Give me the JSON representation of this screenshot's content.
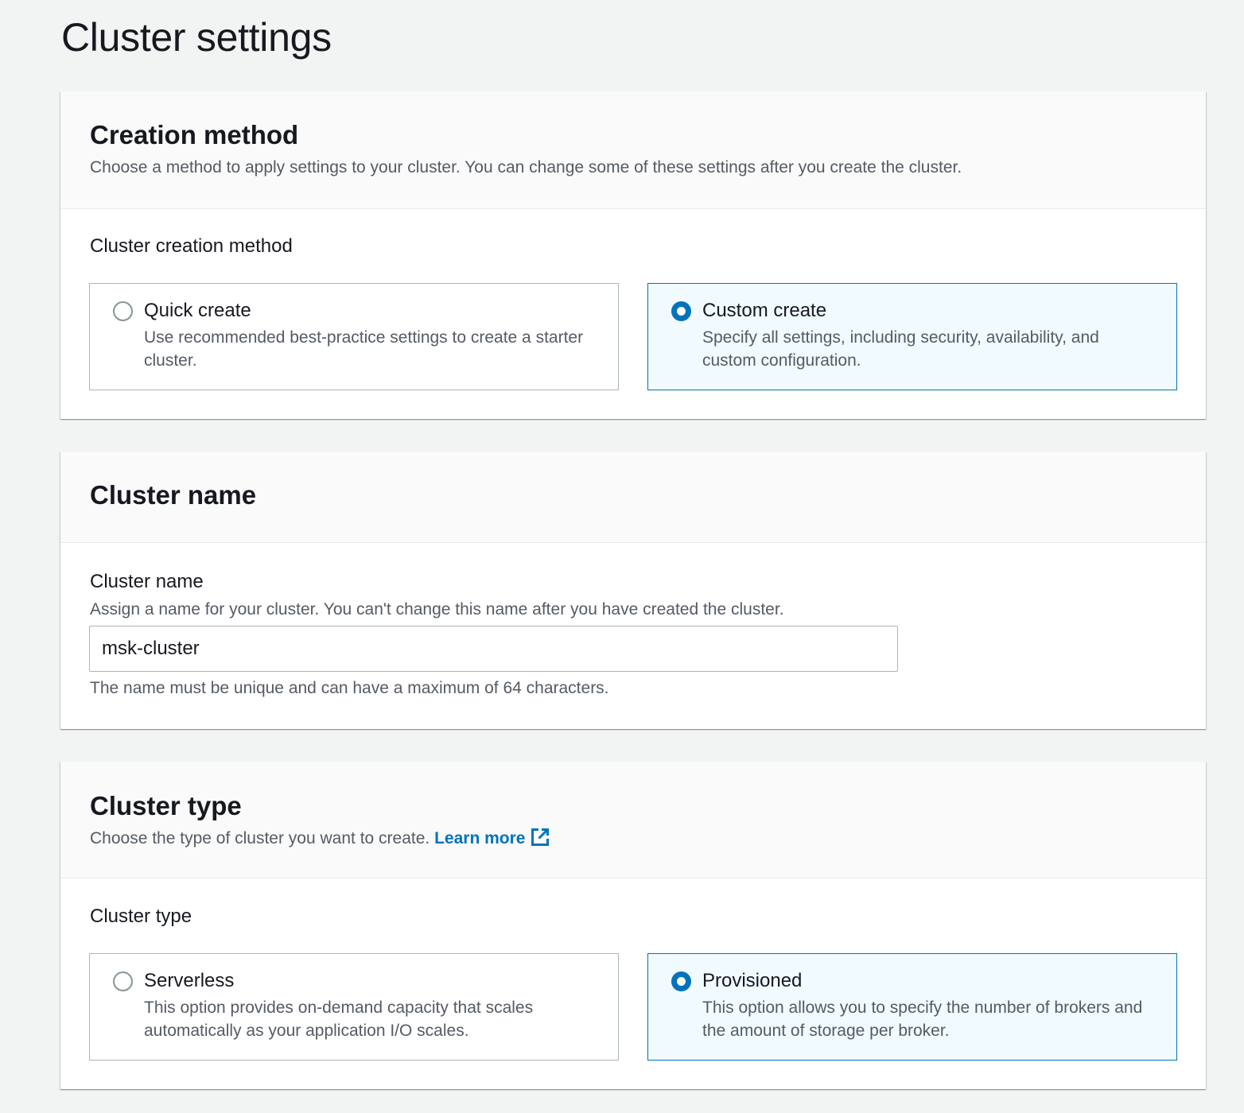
{
  "page": {
    "title": "Cluster settings"
  },
  "creation_method": {
    "heading": "Creation method",
    "description": "Choose a method to apply settings to your cluster. You can change some of these settings after you create the cluster.",
    "field_label": "Cluster creation method",
    "options": [
      {
        "title": "Quick create",
        "description": "Use recommended best-practice settings to create a starter cluster.",
        "selected": false
      },
      {
        "title": "Custom create",
        "description": "Specify all settings, including security, availability, and custom configuration.",
        "selected": true
      }
    ]
  },
  "cluster_name": {
    "heading": "Cluster name",
    "field_label": "Cluster name",
    "field_description": "Assign a name for your cluster. You can't change this name after you have created the cluster.",
    "value": "msk-cluster",
    "constraint": "The name must be unique and can have a maximum of 64 characters."
  },
  "cluster_type": {
    "heading": "Cluster type",
    "description": "Choose the type of cluster you want to create.",
    "learn_more": "Learn more",
    "field_label": "Cluster type",
    "options": [
      {
        "title": "Serverless",
        "description": "This option provides on-demand capacity that scales automatically as your application I/O scales.",
        "selected": false
      },
      {
        "title": "Provisioned",
        "description": "This option allows you to specify the number of brokers and the amount of storage per broker.",
        "selected": true
      }
    ]
  },
  "icons": {
    "external_link": "external-link-icon"
  },
  "colors": {
    "accent": "#0073bb",
    "selected_tile_bg": "#f1faff",
    "page_bg": "#f2f3f3"
  }
}
